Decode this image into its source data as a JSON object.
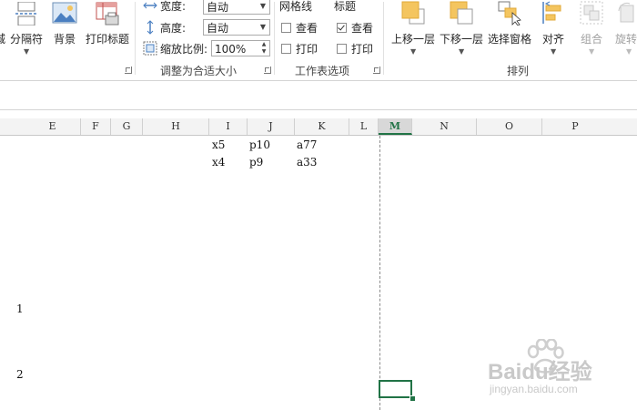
{
  "ribbon": {
    "page_setup": {
      "breaks_label": "分隔符",
      "background_label": "背景",
      "print_titles_label": "打印标题"
    },
    "scale_to_fit": {
      "width_label": "宽度:",
      "width_value": "自动",
      "height_label": "高度:",
      "height_value": "自动",
      "scale_label": "缩放比例:",
      "scale_value": "100%",
      "group_label": "调整为合适大小"
    },
    "sheet_options": {
      "gridlines_header": "网格线",
      "gridlines_view_label": "查看",
      "gridlines_view_checked": false,
      "gridlines_print_label": "打印",
      "gridlines_print_checked": false,
      "headings_header": "标题",
      "headings_view_label": "查看",
      "headings_view_checked": true,
      "headings_print_label": "打印",
      "headings_print_checked": false,
      "group_label": "工作表选项"
    },
    "arrange": {
      "bring_forward_label": "上移一层",
      "send_backward_label": "下移一层",
      "selection_pane_label": "选择窗格",
      "align_label": "对齐",
      "group_label_btn": "组合",
      "rotate_label": "旋转",
      "group_label": "排列"
    }
  },
  "columns": [
    "E",
    "F",
    "G",
    "H",
    "I",
    "J",
    "K",
    "L",
    "M",
    "N",
    "O",
    "P"
  ],
  "selected_column": "M",
  "cells": {
    "r1_I": "x5",
    "r1_J": "p10",
    "r1_K": "a77",
    "r2_I": "x4",
    "r2_J": "p9",
    "r2_K": "a33",
    "left_1": "1",
    "left_2": "2"
  },
  "watermark": {
    "brand": "Baidu经验",
    "url": "jingyan.baidu.com"
  },
  "colors": {
    "accent": "#217346",
    "icon_orange": "#f4c55f",
    "icon_blue": "#4a7fc1"
  }
}
